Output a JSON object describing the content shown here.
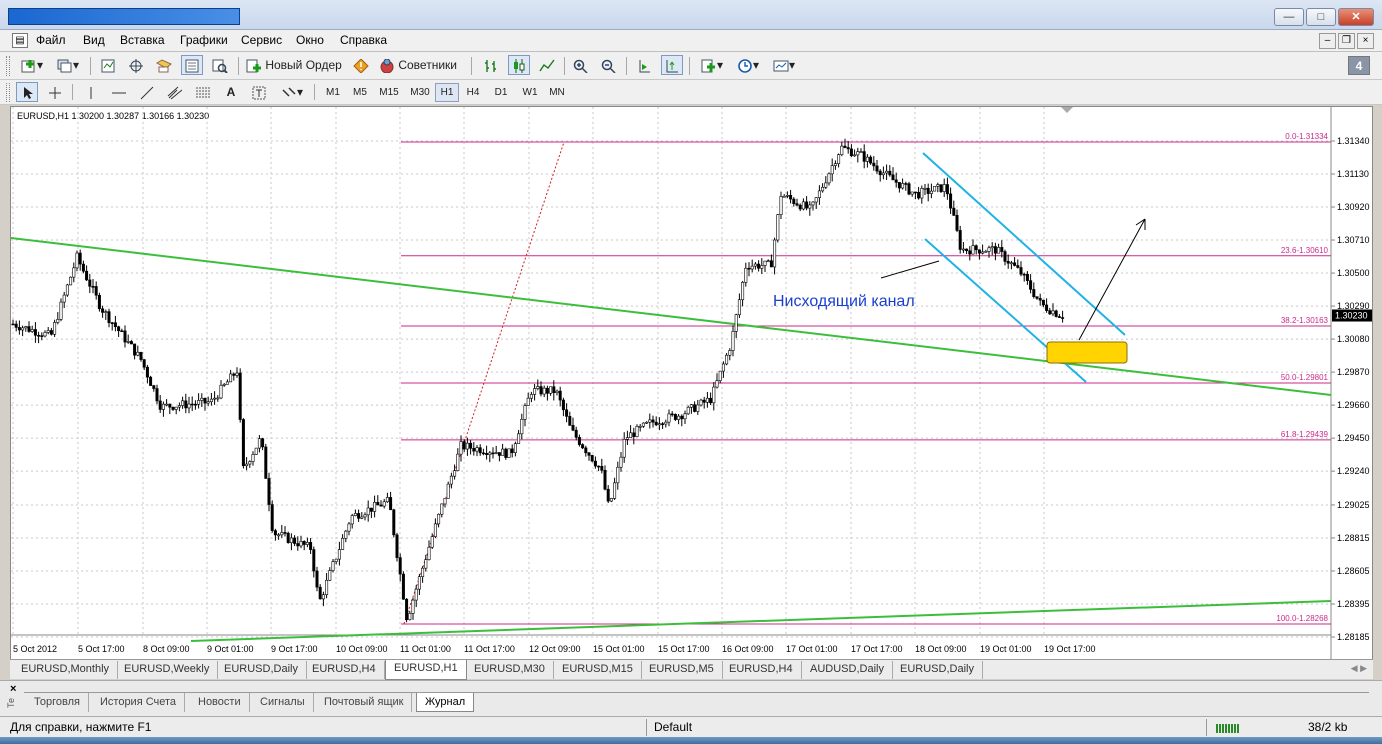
{
  "menu": {
    "items": [
      "Файл",
      "Вид",
      "Вставка",
      "Графики",
      "Сервис",
      "Окно",
      "Справка"
    ]
  },
  "toolbar": {
    "new_order_label": "Новый Ордер",
    "experts_label": "Советники",
    "timeframes": [
      "M1",
      "M5",
      "M15",
      "M30",
      "H1",
      "H4",
      "D1",
      "W1",
      "MN"
    ],
    "active_timeframe": "H1",
    "badge": "4"
  },
  "chart": {
    "info": "EURUSD,H1  1.30200 1.30287 1.30166 1.30230",
    "annotation": "Нисходящий канал",
    "current_price": "1.30230",
    "price_labels": [
      "1.31340",
      "1.31130",
      "1.30920",
      "1.30710",
      "1.30500",
      "1.30290",
      "1.30080",
      "1.29870",
      "1.29660",
      "1.29450",
      "1.29240",
      "1.29025",
      "1.28815",
      "1.28605",
      "1.28395",
      "1.28185"
    ],
    "time_labels": [
      "5 Oct 2012",
      "5 Oct 17:00",
      "8 Oct 09:00",
      "9 Oct 01:00",
      "9 Oct 17:00",
      "10 Oct 09:00",
      "11 Oct 01:00",
      "11 Oct 17:00",
      "12 Oct 09:00",
      "15 Oct 01:00",
      "15 Oct 17:00",
      "16 Oct 09:00",
      "17 Oct 01:00",
      "17 Oct 17:00",
      "18 Oct 09:00",
      "19 Oct 01:00",
      "19 Oct 17:00"
    ],
    "fibo_labels": [
      {
        "text": "0.0-1.31334",
        "level": 1.31334
      },
      {
        "text": "23.6-1.30610",
        "level": 1.3061
      },
      {
        "text": "38.2-1.30163",
        "level": 1.30163
      },
      {
        "text": "50.0-1.29801",
        "level": 1.29801
      },
      {
        "text": "61.8-1.29439",
        "level": 1.29439
      },
      {
        "text": "100.0-1.28268",
        "level": 1.28268
      }
    ],
    "colors": {
      "fibo": "#cc2a8a",
      "trend": "#3bbf3b",
      "channel": "#1fb2e6",
      "text": "#1a3fd0",
      "zone": "#ffd400"
    }
  },
  "chart_tabs": [
    "EURUSD,Monthly",
    "EURUSD,Weekly",
    "EURUSD,Daily",
    "EURUSD,H4",
    "EURUSD,H1",
    "EURUSD,M30",
    "EURUSD,M15",
    "EURUSD,M5",
    "EURUSD,H4",
    "AUDUSD,Daily",
    "EURUSD,Daily"
  ],
  "active_chart_tab": "EURUSD,H1",
  "terminal": {
    "side_label": "Те",
    "tabs": [
      "Торговля",
      "История Счета",
      "Новости",
      "Сигналы",
      "Почтовый ящик",
      "Журнал"
    ],
    "active": "Журнал"
  },
  "status": {
    "help": "Для справки, нажмите F1",
    "profile": "Default",
    "traffic": "38/2 kb"
  }
}
